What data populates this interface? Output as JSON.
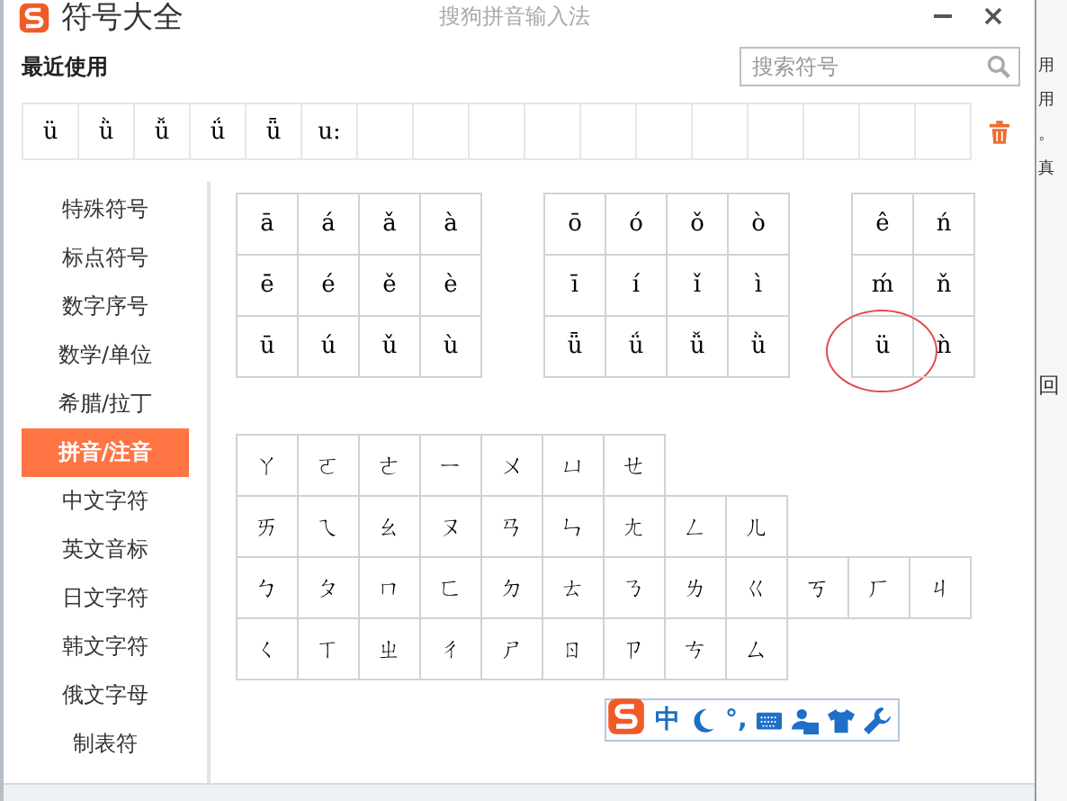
{
  "window": {
    "title": "符号大全",
    "subtitle": "搜狗拼音输入法"
  },
  "recent": {
    "label": "最近使用",
    "symbols": [
      "ü",
      "ǜ",
      "ǚ",
      "ǘ",
      "ǖ",
      "u:"
    ]
  },
  "search": {
    "placeholder": "搜索符号"
  },
  "sidebar": {
    "items": [
      {
        "label": "特殊符号",
        "selected": false
      },
      {
        "label": "标点符号",
        "selected": false
      },
      {
        "label": "数字序号",
        "selected": false
      },
      {
        "label": "数学/单位",
        "selected": false
      },
      {
        "label": "希腊/拉丁",
        "selected": false
      },
      {
        "label": "拼音/注音",
        "selected": true
      },
      {
        "label": "中文字符",
        "selected": false
      },
      {
        "label": "英文音标",
        "selected": false
      },
      {
        "label": "日文字符",
        "selected": false
      },
      {
        "label": "韩文字符",
        "selected": false
      },
      {
        "label": "俄文字母",
        "selected": false
      },
      {
        "label": "制表符",
        "selected": false
      }
    ]
  },
  "pinyin_groups": [
    {
      "rows": [
        [
          {
            "symbol": "ā",
            "circled": false
          },
          {
            "symbol": "á",
            "circled": false
          },
          {
            "symbol": "ǎ",
            "circled": false
          },
          {
            "symbol": "à",
            "circled": false
          }
        ],
        [
          {
            "symbol": "ē",
            "circled": false
          },
          {
            "symbol": "é",
            "circled": false
          },
          {
            "symbol": "ě",
            "circled": false
          },
          {
            "symbol": "è",
            "circled": false
          }
        ],
        [
          {
            "symbol": "ū",
            "circled": false
          },
          {
            "symbol": "ú",
            "circled": false
          },
          {
            "symbol": "ǔ",
            "circled": false
          },
          {
            "symbol": "ù",
            "circled": false
          }
        ]
      ]
    },
    {
      "rows": [
        [
          {
            "symbol": "ō",
            "circled": false
          },
          {
            "symbol": "ó",
            "circled": false
          },
          {
            "symbol": "ǒ",
            "circled": false
          },
          {
            "symbol": "ò",
            "circled": false
          }
        ],
        [
          {
            "symbol": "ī",
            "circled": false
          },
          {
            "symbol": "í",
            "circled": false
          },
          {
            "symbol": "ǐ",
            "circled": false
          },
          {
            "symbol": "ì",
            "circled": false
          }
        ],
        [
          {
            "symbol": "ǖ",
            "circled": false
          },
          {
            "symbol": "ǘ",
            "circled": false
          },
          {
            "symbol": "ǚ",
            "circled": false
          },
          {
            "symbol": "ǜ",
            "circled": false
          }
        ]
      ]
    },
    {
      "rows": [
        [
          {
            "symbol": "ê",
            "circled": false
          },
          {
            "symbol": "ń",
            "circled": false
          }
        ],
        [
          {
            "symbol": "ḿ",
            "circled": false
          },
          {
            "symbol": "ň",
            "circled": false
          }
        ],
        [
          {
            "symbol": "ü",
            "circled": true
          },
          {
            "symbol": "ǹ",
            "circled": false
          }
        ]
      ]
    }
  ],
  "zhuyin_rows": [
    [
      "ㄚ",
      "ㄛ",
      "ㄜ",
      "ㄧ",
      "ㄨ",
      "ㄩ",
      "ㄝ"
    ],
    [
      "ㄞ",
      "ㄟ",
      "ㄠ",
      "ㄡ",
      "ㄢ",
      "ㄣ",
      "ㄤ",
      "ㄥ",
      "ㄦ"
    ],
    [
      "ㄅ",
      "ㄆ",
      "ㄇ",
      "ㄈ",
      "ㄉ",
      "ㄊ",
      "ㄋ",
      "ㄌ",
      "ㄍ",
      "ㄎ",
      "ㄏ",
      "ㄐ"
    ],
    [
      "ㄑ",
      "ㄒ",
      "ㄓ",
      "ㄔ",
      "ㄕ",
      "ㄖ",
      "ㄗ",
      "ㄘ",
      "ㄙ"
    ]
  ],
  "ime_toolbar": [
    {
      "kind": "logo"
    },
    {
      "kind": "text",
      "label": "中"
    },
    {
      "kind": "moon"
    },
    {
      "kind": "text",
      "label": "°,"
    },
    {
      "kind": "keyboard"
    },
    {
      "kind": "user"
    },
    {
      "kind": "shirt"
    },
    {
      "kind": "wrench"
    }
  ],
  "background": {
    "snippets": [
      "用",
      "用",
      "。",
      "真",
      "回"
    ]
  }
}
